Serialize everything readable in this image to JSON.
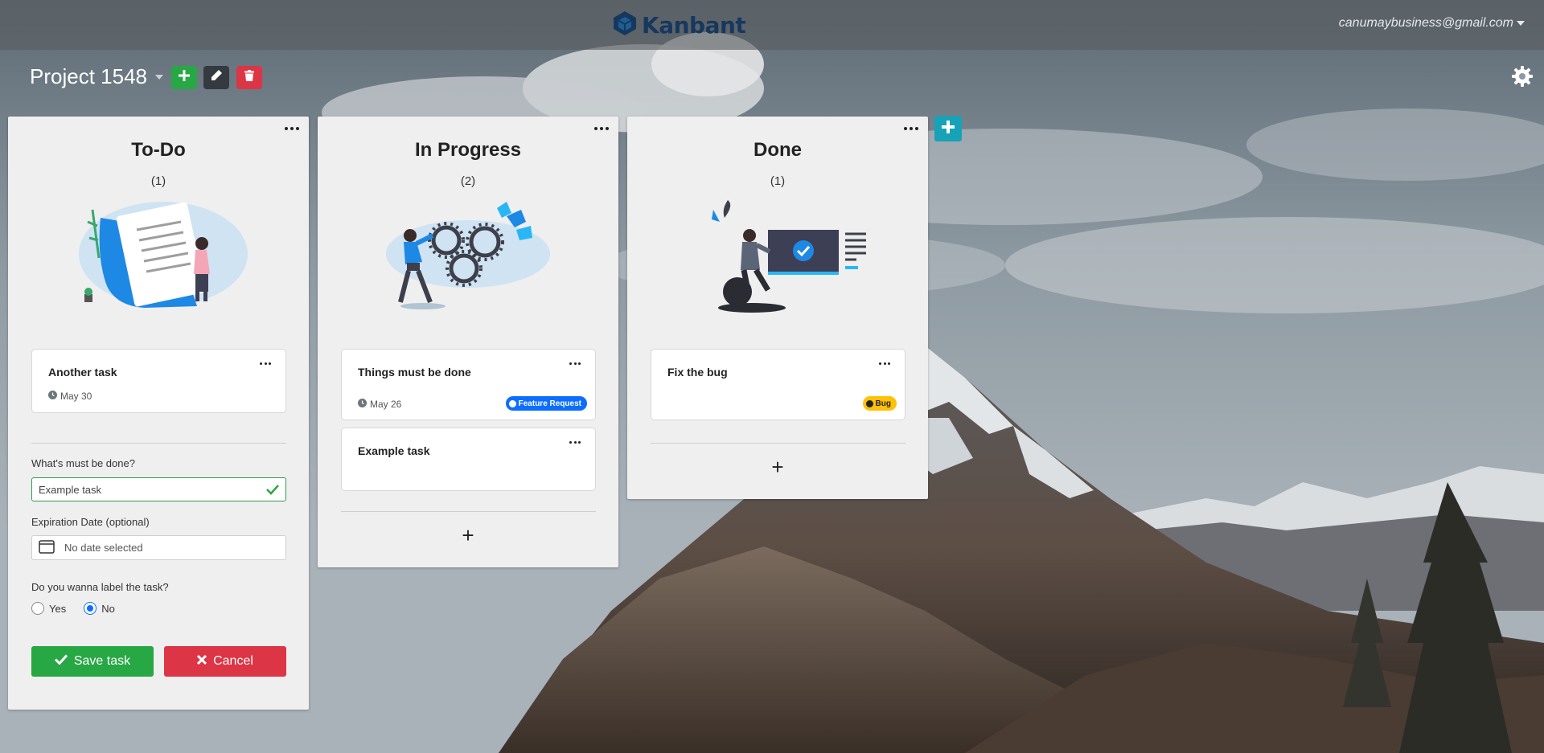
{
  "navbar": {
    "brand_name": "Kanbant",
    "brand_logo": "cube-logo-icon",
    "user_email": "canumaybusiness@gmail.com"
  },
  "project": {
    "title": "Project 1548",
    "actions": [
      "plus-icon",
      "pencil-icon",
      "trash-icon"
    ],
    "settings_icon": "gear-icon"
  },
  "lists": [
    {
      "title": "To-Do",
      "count": "(1)",
      "illustration": "document-reading-illustration",
      "cards": [
        {
          "title": "Another task",
          "date": "May 30"
        }
      ]
    },
    {
      "title": "In Progress",
      "count": "(2)",
      "illustration": "gears-illustration",
      "cards": [
        {
          "title": "Things must be done",
          "date": "May 26",
          "label": "Feature Request"
        },
        {
          "title": "Example task"
        }
      ],
      "add_label": "+"
    },
    {
      "title": "Done",
      "count": "(1)",
      "illustration": "completed-task-illustration",
      "cards": [
        {
          "title": "Fix the bug",
          "label": "Bug"
        }
      ],
      "add_label": "+"
    }
  ],
  "new_task_form": {
    "task_label": "What's must be done?",
    "task_value": "Example task",
    "date_label": "Expiration Date (optional)",
    "date_placeholder": "No date selected",
    "label_question": "Do you wanna label the task?",
    "option_yes": "Yes",
    "option_no": "No",
    "selected_option": "No",
    "save_label": "Save task",
    "cancel_label": "Cancel"
  },
  "colors": {
    "green": "#28a745",
    "red": "#dc3545",
    "dark": "#343a40",
    "teal": "#17a2b8",
    "blue": "#0d6efd",
    "yellow": "#ffc107",
    "brand": "#17385e"
  }
}
